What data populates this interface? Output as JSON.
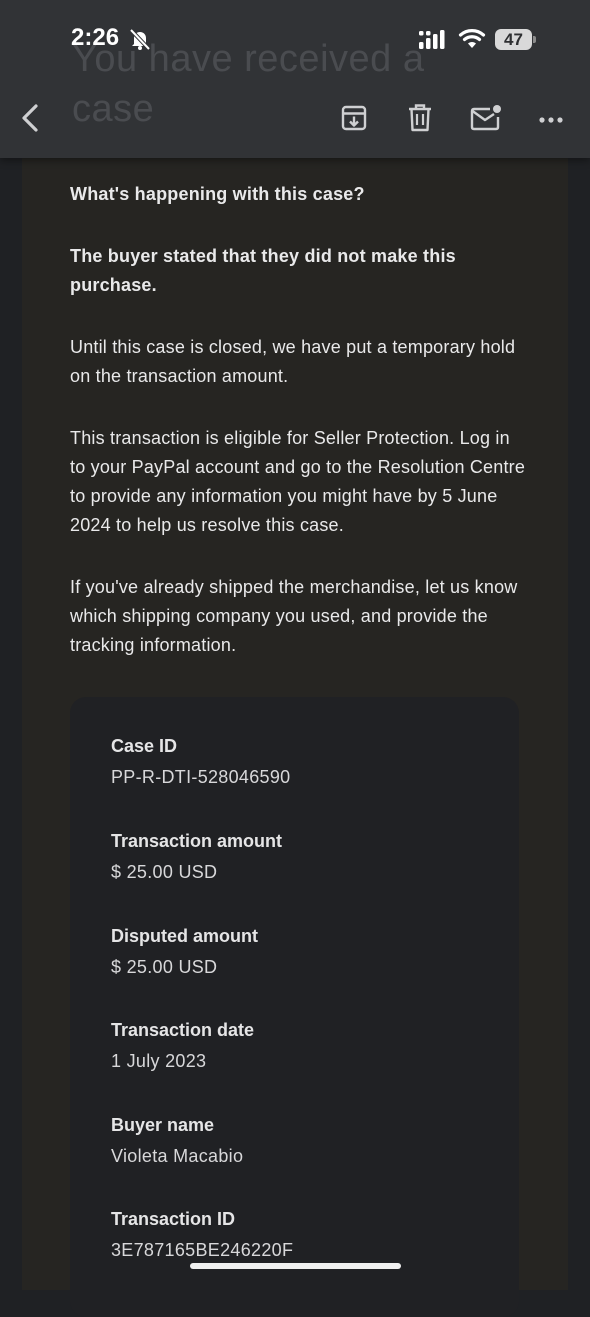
{
  "status_bar": {
    "time": "2:26",
    "battery": "47",
    "icons": [
      "bell-slash-icon",
      "signal-icon",
      "wifi-icon",
      "battery-icon"
    ]
  },
  "toolbar": {
    "subject_ghost": "You have received a case",
    "icons": [
      "back-icon",
      "archive-icon",
      "trash-icon",
      "mark-unread-icon",
      "more-icon"
    ]
  },
  "email": {
    "heading": "What's happening with this case?",
    "buyer_statement": "The buyer stated that they did not make this purchase.",
    "hold_text": "Until this case is closed, we have put a temporary hold on the transaction amount.",
    "protection_text": "This transaction is eligible for Seller Protection. Log in to your PayPal account and go to the Resolution Centre to provide any information you might have by 5 June 2024 to help us resolve this case.",
    "shipping_text": "If you've already shipped the merchandise, let us know which shipping company you used, and provide the tracking information."
  },
  "details": [
    {
      "label": "Case ID",
      "value": "PP-R-DTI-528046590"
    },
    {
      "label": "Transaction amount",
      "value": "$ 25.00 USD"
    },
    {
      "label": "Disputed amount",
      "value": "$ 25.00 USD"
    },
    {
      "label": "Transaction date",
      "value": "1 July 2023"
    },
    {
      "label": "Buyer name",
      "value": "Violeta Macabio"
    },
    {
      "label": "Transaction ID",
      "value": "3E787165BE246220F"
    }
  ],
  "colors": {
    "page_bg": "#1f2124",
    "email_bg": "#262522",
    "toolbar_bg": "#313336",
    "details_bg": "#202124",
    "text": "#e9e9ea"
  }
}
